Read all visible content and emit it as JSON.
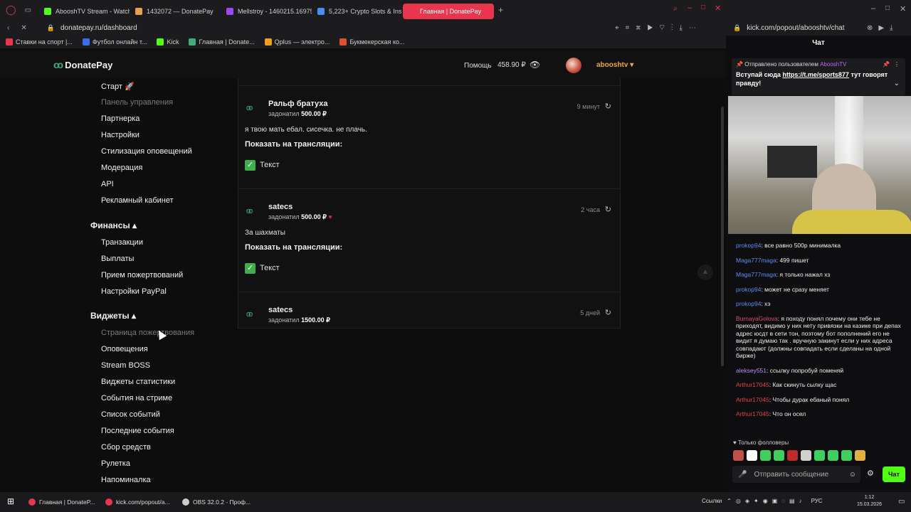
{
  "browser": {
    "tabs": [
      {
        "label": "AbooshTV Stream - Watch",
        "color": "#53fc18"
      },
      {
        "label": "1432072 — DonatePay",
        "color": "#e8a050"
      },
      {
        "label": "Mellstroy - 1460215.16975",
        "color": "#9a4cf0"
      },
      {
        "label": "5,223+ Crypto Slots & Ins",
        "color": "#4a8ef0"
      },
      {
        "label": "Главная | DonatePay",
        "color": "#e8364f"
      }
    ],
    "url": "donatepay.ru/dashboard",
    "chat_url": "kick.com/popout/abooshtv/chat",
    "bookmarks": [
      {
        "label": "Ставки на спорт |...",
        "color": "#e8364f"
      },
      {
        "label": "Футбол онлайн т...",
        "color": "#3a6ee8"
      },
      {
        "label": "Kick",
        "color": "#53fc18"
      },
      {
        "label": "Главная | Donate...",
        "color": "#3fae7c"
      },
      {
        "label": "Qplus — электро...",
        "color": "#f0a020"
      },
      {
        "label": "Букмекерская ко...",
        "color": "#e05030"
      }
    ]
  },
  "header": {
    "brand": "DonatePay",
    "help": "Помощь",
    "balance": "458.90 ₽",
    "username": "abooshtv ▾"
  },
  "sidebar": {
    "items": [
      {
        "label": "Старт 🚀",
        "dim": false
      },
      {
        "label": "Панель управления",
        "dim": true
      },
      {
        "label": "Партнерка",
        "dim": false
      },
      {
        "label": "Настройки",
        "dim": false
      },
      {
        "label": "Стилизация оповещений",
        "dim": false
      },
      {
        "label": "Модерация",
        "dim": false
      },
      {
        "label": "API",
        "dim": false
      },
      {
        "label": "Рекламный кабинет",
        "dim": false
      }
    ],
    "finance_title": "Финансы ▴",
    "finance_items": [
      "Транзакции",
      "Выплаты",
      "Прием пожертвований",
      "Настройки PayPal"
    ],
    "widgets_title": "Виджеты ▴",
    "widgets_items": [
      {
        "label": "Страница пожертвования",
        "dim": true
      },
      {
        "label": "Оповещения",
        "dim": false
      },
      {
        "label": "Stream BOSS",
        "dim": false
      },
      {
        "label": "Виджеты статистики",
        "dim": false
      },
      {
        "label": "События на стриме",
        "dim": false
      },
      {
        "label": "Список событий",
        "dim": false
      },
      {
        "label": "Последние события",
        "dim": false
      },
      {
        "label": "Сбор средств",
        "dim": false
      },
      {
        "label": "Рулетка",
        "dim": false
      },
      {
        "label": "Напоминалка",
        "dim": false
      }
    ]
  },
  "donations": [
    {
      "name": "Ральф братуха",
      "action": "задонатил",
      "amount": "500.00 ₽",
      "time": "9 минут",
      "message": "я твою мать ебал. сисечка. не плачь.",
      "show_label": "Показать на трансляции:",
      "check_label": "Текст",
      "heart": false
    },
    {
      "name": "satecs",
      "action": "задонатил",
      "amount": "500.00 ₽",
      "time": "2 часа",
      "message": "За шахматы",
      "show_label": "Показать на трансляции:",
      "check_label": "Текст",
      "heart": true
    },
    {
      "name": "satecs",
      "action": "задонатил",
      "amount": "1500.00 ₽",
      "time": "5 дней",
      "message": "",
      "show_label": "",
      "check_label": "",
      "heart": false
    }
  ],
  "chat": {
    "title": "Чат",
    "pinned_head": "Отправлено пользователем",
    "pinned_by": "AbooshTV",
    "pinned_text_pre": "Вступай сюда ",
    "pinned_link": "https://t.me/sports877",
    "pinned_text_post": " тут говорят правду!",
    "messages": [
      {
        "user": "prokop94",
        "color": "#5b8cf5",
        "text": ": все равно 500р минималка"
      },
      {
        "user": "Maga777maga",
        "color": "#5b8cf5",
        "text": ": 499 пишет"
      },
      {
        "user": "Maga777maga",
        "color": "#5b8cf5",
        "text": ": я только нажал хз"
      },
      {
        "user": "prokop94",
        "color": "#5b8cf5",
        "text": ": может не сразу меняет"
      },
      {
        "user": "prokop94",
        "color": "#5b8cf5",
        "text": ": хз"
      },
      {
        "user": "BurnayaGolova",
        "color": "#e24a6a",
        "text": ": я походу понял почему они тебе не приходят, видимо у них нету привязки на казике при депах адрес юсдт в сети тон, поэтому бот пополнений его не видит я думаю так . вручную закинут если у них адреса совпадают (должны совпадать если сделаны на одной бирже)"
      },
      {
        "user": "aleksey551",
        "color": "#b98cf5",
        "text": ": ссылку попробуй поменяй"
      },
      {
        "user": "Arthur17045",
        "color": "#e2404a",
        "text": ": Как скинуть сылку щас"
      },
      {
        "user": "Arthur17045",
        "color": "#e2404a",
        "text": ": Чтобы дурак ебаный понял"
      },
      {
        "user": "Arthur17045",
        "color": "#e2404a",
        "text": ": Что он осел"
      }
    ],
    "followers_only": "♥ Только фолловеры",
    "input_placeholder": "Отправить сообщение",
    "send_label": "Чат"
  },
  "taskbar": {
    "apps": [
      {
        "label": "Главная | DonateP...",
        "color": "#e8364f"
      },
      {
        "label": "kick.com/popout/a...",
        "color": "#e8364f"
      },
      {
        "label": "OBS 32.0.2 - Проф...",
        "color": "#cccccc"
      }
    ],
    "links": "Ссылки",
    "lang": "РУС",
    "time": "1:12",
    "date": "15.03.2026"
  }
}
